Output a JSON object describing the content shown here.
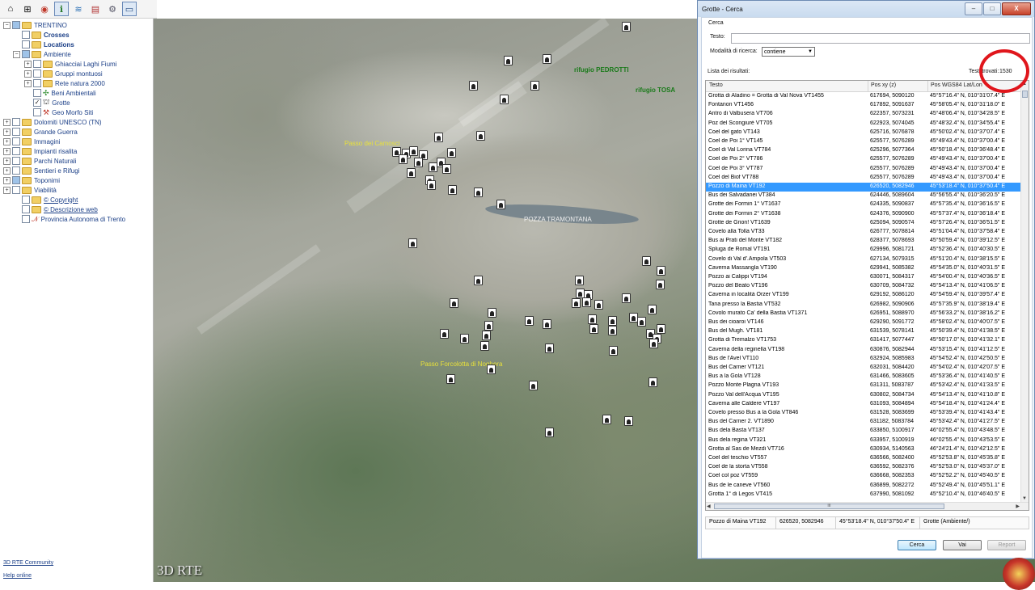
{
  "toolbar": {
    "icons": [
      "home-icon",
      "grid-icon",
      "target-icon",
      "info-icon",
      "layers-icon",
      "document-icon",
      "settings-icon",
      "monitor-icon"
    ]
  },
  "tree": {
    "root": "TRENTINO",
    "items": [
      {
        "label": "Crosses"
      },
      {
        "label": "Locations"
      },
      {
        "label": "Ambiente"
      },
      {
        "label": "Ghiacciai Laghi Fiumi"
      },
      {
        "label": "Gruppi montuosi"
      },
      {
        "label": "Rete natura 2000"
      },
      {
        "label": "Beni Ambientali"
      },
      {
        "label": "Grotte"
      },
      {
        "label": "Geo Morfo Siti"
      },
      {
        "label": "Dolomiti UNESCO (TN)"
      },
      {
        "label": "Grande Guerra"
      },
      {
        "label": "Immagini"
      },
      {
        "label": "Impianti risalita"
      },
      {
        "label": "Parchi Naturali"
      },
      {
        "label": "Sentieri e Rifugi"
      },
      {
        "label": "Toponimi"
      },
      {
        "label": "Viabilità"
      },
      {
        "label": "© Copyright"
      },
      {
        "label": "© Descrizione web"
      },
      {
        "label": "Provincia Autonoma di Trento"
      }
    ]
  },
  "bottom_links": {
    "community": "3D RTE Community",
    "help": "Help online"
  },
  "map": {
    "logo": "3D RTE",
    "labels": {
      "passo": "Passo dei Camosci",
      "pedrotti": "rifugio PEDROTTI",
      "tosa": "rifugio TOSA",
      "pozza": "POZZA TRAMONTANA",
      "forcolotta": "Passo Forcolotta di Noghera"
    }
  },
  "dialog": {
    "title": "Grotte - Cerca",
    "window_buttons": {
      "minimize": "–",
      "maximize": "□",
      "close": "X"
    },
    "section_label": "Cerca",
    "testo_label": "Testo:",
    "testo_value": "",
    "mode_label": "Modalità di ricerca:",
    "mode_value": "contiene",
    "results_label": "Lista dei risultati:",
    "count_prefix": "Testi trovati:",
    "count": "1530",
    "columns": {
      "testo": "Testo",
      "pos": "Pos xy (z)",
      "wgs": "Pos WGS84 Lat/Lon"
    },
    "rows": [
      [
        "Grotta di Aladino = Grotta di Val Nova VT1455",
        "617694, 5090120",
        "45°57'16.4\" N, 010°31'07.4\" E"
      ],
      [
        "Fontanon VT1456",
        "617892, 5091637",
        "45°58'05.4\" N, 010°31'18.0\" E"
      ],
      [
        "Antro di Valbusera VT706",
        "622357, 5073231",
        "45°48'06.4\" N, 010°34'28.5\" E"
      ],
      [
        "Poz del Scongiurè VT705",
        "622923, 5074045",
        "45°48'32.4\" N, 010°34'55.4\" E"
      ],
      [
        "Coel del gato VT143",
        "625716, 5076878",
        "45°50'02.4\" N, 010°37'07.4\" E"
      ],
      [
        "Coel de Poi 1° VT145",
        "625577, 5076289",
        "45°49'43.4\" N, 010°37'00.4\" E"
      ],
      [
        "Coel di Val Lorina VT784",
        "625296, 5077364",
        "45°50'18.4\" N, 010°36'48.4\" E"
      ],
      [
        "Coel de Poi 2° VT786",
        "625577, 5076289",
        "45°49'43.4\" N, 010°37'00.4\" E"
      ],
      [
        "Coel de Poi 3° VT787",
        "625577, 5076289",
        "45°49'43.4\" N, 010°37'00.4\" E"
      ],
      [
        "Coel del Biof VT788",
        "625577, 5076289",
        "45°49'43.4\" N, 010°37'00.4\" E"
      ],
      [
        "Pozzo di Maina VT192",
        "626520, 5082946",
        "45°53'18.4\" N, 010°37'50.4\" E"
      ],
      [
        "Bus dei Salvadanei VT384",
        "624446, 5089604",
        "45°56'55.4\" N, 010°36'20.5\" E"
      ],
      [
        "Grotte dei Formin 1° VT1637",
        "624335, 5090837",
        "45°57'35.4\" N, 010°36'16.5\" E"
      ],
      [
        "Grotte dei Formin 2° VT1638",
        "624376, 5090900",
        "45°57'37.4\" N, 010°36'18.4\" E"
      ],
      [
        "Grotte de Grion! VT1639",
        "625094, 5090574",
        "45°57'26.4\" N, 010°36'51.5\" E"
      ],
      [
        "Covelo alla Tolla VT33",
        "626777, 5078814",
        "45°51'04.4\" N, 010°37'58.4\" E"
      ],
      [
        "Bus ai Prati del Monte VT182",
        "628377, 5078693",
        "45°50'59.4\" N, 010°39'12.5\" E"
      ],
      [
        "Spluga de Romal VT191",
        "629996, 5081721",
        "45°52'36.4\" N, 010°40'30.5\" E"
      ],
      [
        "Covelo di Val d'.Ampola VT503",
        "627134, 5079315",
        "45°51'20.4\" N, 010°38'15.5\" E"
      ],
      [
        "Caverna Massangla VT190",
        "629941, 5085382",
        "45°54'35.0\" N, 010°40'31.5\" E"
      ],
      [
        "Pozzo ai Calippi VT194",
        "630071, 5084317",
        "45°54'00.4\" N, 010°40'36.5\" E"
      ],
      [
        "Pozzo del Beato VT196",
        "630709, 5084732",
        "45°54'13.4\" N, 010°41'06.5\" E"
      ],
      [
        "Caverna in località Orzer VT199",
        "629192, 5086120",
        "45°54'59.4\" N, 010°39'57.4\" E"
      ],
      [
        "Tana presso la Bastia VT532",
        "626982, 5090906",
        "45°57'35.9\" N, 010°38'19.4\" E"
      ],
      [
        "Covolo murato Ca' della Bastia VT1371",
        "626951, 5088970",
        "45°56'33.2\" N, 010°38'16.2\" E"
      ],
      [
        "Bus dei cioaroi VT146",
        "629290, 5091772",
        "45°58'02.4\" N, 010°40'07.5\" E"
      ],
      [
        "Bus del Mugh. VT181",
        "631539, 5078141",
        "45°50'39.4\" N, 010°41'38.5\" E"
      ],
      [
        "Grotta di Tremalzo VT1753",
        "631417, 5077447",
        "45°50'17.0\" N, 010°41'32.1\" E"
      ],
      [
        "Caverna della reginella VT198",
        "630876, 5082944",
        "45°53'15.4\" N, 010°41'12.5\" E"
      ],
      [
        "Bus de l'Avel VT110",
        "632924, 5085983",
        "45°54'52.4\" N, 010°42'50.5\" E"
      ],
      [
        "Bus del Carner VT121",
        "632031, 5084420",
        "45°54'02.4\" N, 010°42'07.5\" E"
      ],
      [
        "Bus a la Gola VT128",
        "631466, 5083605",
        "45°53'36.4\" N, 010°41'40.5\" E"
      ],
      [
        "Pozzo Monte Plagna VT193",
        "631311, 5083787",
        "45°53'42.4\" N, 010°41'33.5\" E"
      ],
      [
        "Pozzo Val dell'Acqua VT195",
        "630802, 5084734",
        "45°54'13.4\" N, 010°41'10.8\" E"
      ],
      [
        "Caverna alle Caldere VT197",
        "631093, 5084894",
        "45°54'18.4\" N, 010°41'24.4\" E"
      ],
      [
        "Covelo presso Bus a la Gola VT846",
        "631528, 5083699",
        "45°53'39.4\" N, 010°41'43.4\" E"
      ],
      [
        "Bus del Carner 2. VT1890",
        "631182, 5083784",
        "45°53'42.4\" N, 010°41'27.5\" E"
      ],
      [
        "Bus dela Basta VT137",
        "633850, 5100917",
        "46°02'55.4\" N, 010°43'48.5\" E"
      ],
      [
        "Bus dela regina VT321",
        "633957, 5100919",
        "46°02'55.4\" N, 010°43'53.5\" E"
      ],
      [
        "Grotta al Sas de Mezdi VT716",
        "630934, 5140563",
        "46°24'21.4\" N, 010°42'12.5\" E"
      ],
      [
        "Coel del teschio VT557",
        "636566, 5082400",
        "45°52'53.8\" N, 010°45'35.8\" E"
      ],
      [
        "Coel de la storta VT558",
        "636592, 5082376",
        "45°52'53.0\" N, 010°45'37.0\" E"
      ],
      [
        "Coel col poz VT559",
        "636668, 5082353",
        "45°52'52.2\" N, 010°45'40.5\" E"
      ],
      [
        "Bus de le caneve VT560",
        "636899, 5082272",
        "45°52'49.4\" N, 010°45'51.1\" E"
      ],
      [
        "Grotta 1° di Legos VT415",
        "637990, 5081092",
        "45°52'10.4\" N, 010°46'40.5\" E"
      ]
    ],
    "selected_index": 10,
    "detail": {
      "name": "Pozzo di Maina VT192",
      "xy": "626520, 5082946",
      "wgs": "45°53'18.4\" N, 010°37'50.4\" E",
      "category": "Grotte (Ambiente/)"
    },
    "scroll_label": "III",
    "buttons": {
      "cerca": "Cerca",
      "vai": "Vai",
      "report": "Report"
    }
  },
  "colors": {
    "selection": "#3399ff",
    "highlight_circle": "#e0161c",
    "tree_text": "#1b3f87",
    "map_label_yellow": "#e9e23a",
    "map_label_green": "#1a7a1a"
  }
}
